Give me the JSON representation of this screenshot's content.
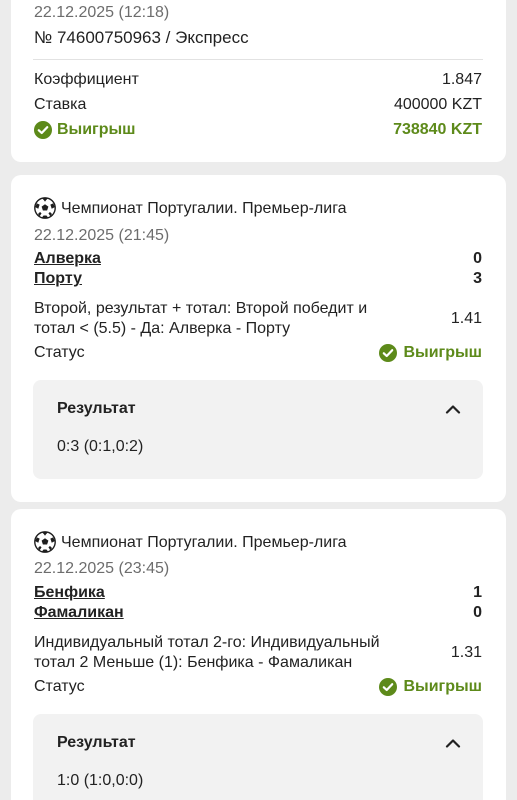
{
  "bet": {
    "datetime": "22.12.2025 (12:18)",
    "number_line": "№ 74600750963 / Экспресс",
    "coef_label": "Коэффициент",
    "coef_value": "1.847",
    "stake_label": "Ставка",
    "stake_value": "400000 KZT",
    "win_label": "Выигрыш",
    "win_value": "738840 KZT"
  },
  "events": [
    {
      "league": "Чемпионат Португалии. Премьер-лига",
      "datetime": "22.12.2025 (21:45)",
      "team1": "Алверка",
      "team1_score": "0",
      "team2": "Порту",
      "team2_score": "3",
      "market_line1": "Второй, результат + тотал: Второй победит и",
      "market_line2": "тотал < (5.5) - Да: Алверка - Порту",
      "odds": "1.41",
      "status_label": "Статус",
      "status_value": "Выигрыш",
      "result_title": "Результат",
      "result_value": "0:3 (0:1,0:2)"
    },
    {
      "league": "Чемпионат Португалии. Премьер-лига",
      "datetime": "22.12.2025 (23:45)",
      "team1": "Бенфика",
      "team1_score": "1",
      "team2": "Фамаликан",
      "team2_score": "0",
      "market_line1": "Индивидуальный тотал 2-го: Индивидуальный",
      "market_line2": "тотал 2 Меньше (1): Бенфика - Фамаликан",
      "odds": "1.31",
      "status_label": "Статус",
      "status_value": "Выигрыш",
      "result_title": "Результат",
      "result_value": "1:0 (1:0,0:0)"
    }
  ],
  "colors": {
    "win": "#5d8a1a",
    "card": "#ffffff",
    "background": "#ececec",
    "result_box": "#f2f2f2"
  },
  "icons": {
    "win": "check-circle-icon",
    "sport": "soccer-ball-icon",
    "collapse": "chevron-up-icon"
  }
}
